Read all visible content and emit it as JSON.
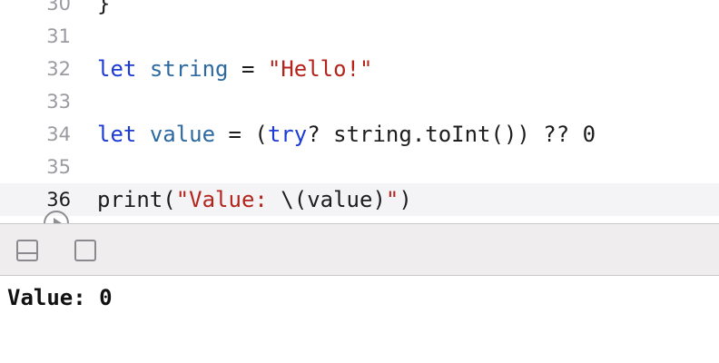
{
  "editor": {
    "lines": [
      {
        "number": "30",
        "tokens": [
          {
            "t": "}",
            "c": "plain"
          }
        ]
      },
      {
        "number": "31",
        "tokens": []
      },
      {
        "number": "32",
        "tokens": [
          {
            "t": "let",
            "c": "kw"
          },
          {
            "t": " ",
            "c": "plain"
          },
          {
            "t": "string",
            "c": "id"
          },
          {
            "t": " = ",
            "c": "plain"
          },
          {
            "t": "\"Hello!\"",
            "c": "str"
          }
        ]
      },
      {
        "number": "33",
        "tokens": []
      },
      {
        "number": "34",
        "tokens": [
          {
            "t": "let",
            "c": "kw"
          },
          {
            "t": " ",
            "c": "plain"
          },
          {
            "t": "value",
            "c": "id"
          },
          {
            "t": " = (",
            "c": "plain"
          },
          {
            "t": "try",
            "c": "kw"
          },
          {
            "t": "? string.toInt()) ?? 0",
            "c": "plain"
          }
        ]
      },
      {
        "number": "35",
        "tokens": []
      },
      {
        "number": "36",
        "current": true,
        "tokens": [
          {
            "t": "print(",
            "c": "plain"
          },
          {
            "t": "\"Value: ",
            "c": "str"
          },
          {
            "t": "\\(value)",
            "c": "plain"
          },
          {
            "t": "\"",
            "c": "str"
          },
          {
            "t": ")",
            "c": "plain"
          }
        ]
      }
    ]
  },
  "console": {
    "output": "Value: 0"
  },
  "icons": {
    "run_marker": "play-circle-icon",
    "hide_debug_area": "bottom-panel-icon",
    "show_console": "square-panel-icon"
  }
}
